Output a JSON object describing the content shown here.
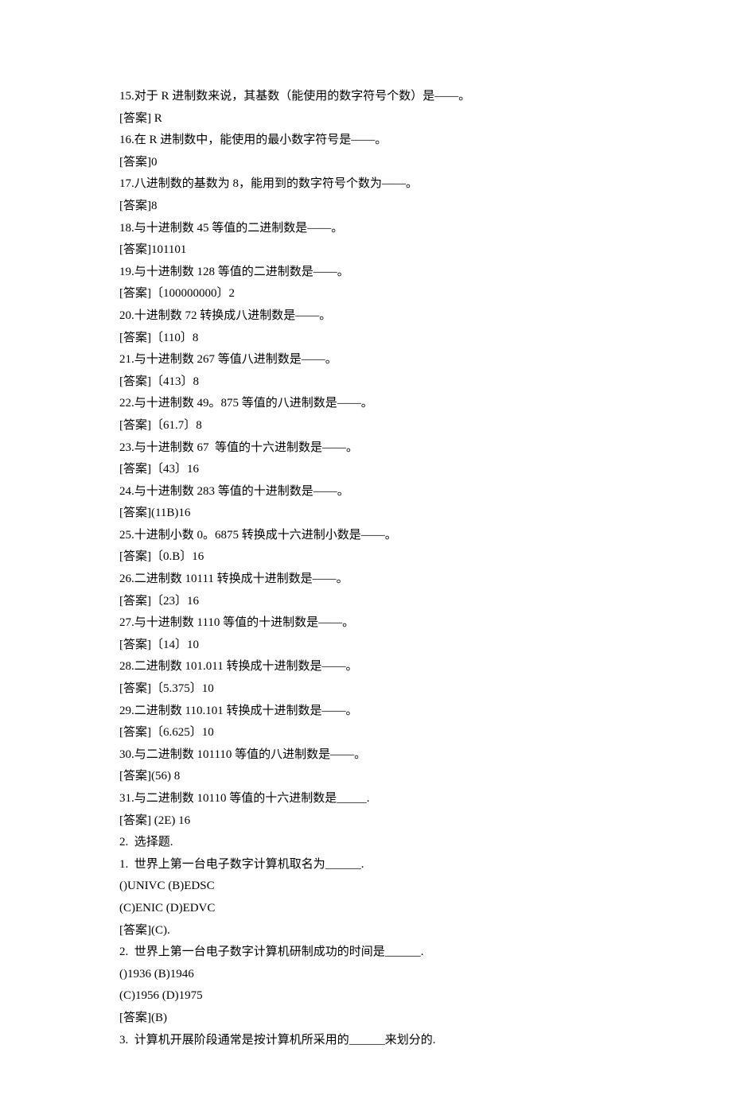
{
  "lines": [
    "15.对于 R 进制数来说，其基数（能使用的数字符号个数）是——。",
    "[答案] R",
    "16.在 R 进制数中，能使用的最小数字符号是——。",
    "[答案]0",
    "17.八进制数的基数为 8，能用到的数字符号个数为——。",
    "[答案]8",
    "18.与十进制数 45 等值的二进制数是——。",
    "[答案]101101",
    "19.与十进制数 128 等值的二进制数是——。",
    "[答案]〔100000000〕2",
    "20.十进制数 72 转换成八进制数是——。",
    "[答案]〔110〕8",
    "21.与十进制数 267 等值八进制数是——。",
    "[答案]〔413〕8",
    "22.与十进制数 49。875 等值的八进制数是——。",
    "[答案]〔61.7〕8",
    "23.与十进制数 67  等值的十六进制数是——。",
    "[答案]〔43〕16",
    "24.与十进制数 283 等值的十进制数是——。",
    "[答案](11B)16",
    "25.十进制小数 0。6875 转换成十六进制小数是——。",
    "[答案]〔0.B〕16",
    "26.二进制数 10111 转换成十进制数是——。",
    "[答案]〔23〕16",
    "27.与十进制数 1110 等值的十进制数是——。",
    "[答案]〔14〕10",
    "28.二进制数 101.011 转换成十进制数是——。",
    "[答案]〔5.375〕10",
    "29.二进制数 110.101 转换成十进制数是——。",
    "[答案]〔6.625〕10",
    "30.与二进制数 101110 等值的八进制数是——。",
    "[答案](56) 8",
    "31.与二进制数 10110 等值的十六进制数是_____.",
    "[答案] (2E) 16",
    "2.  选择题.",
    "1.  世界上第一台电子数字计算机取名为______.",
    "()UNIVC (B)EDSC",
    "(C)ENIC (D)EDVC",
    "[答案](C).",
    "2.  世界上第一台电子数字计算机研制成功的时间是______.",
    "()1936 (B)1946",
    "(C)1956 (D)1975",
    "[答案](B)",
    "3.  计算机开展阶段通常是按计算机所采用的______来划分的."
  ]
}
